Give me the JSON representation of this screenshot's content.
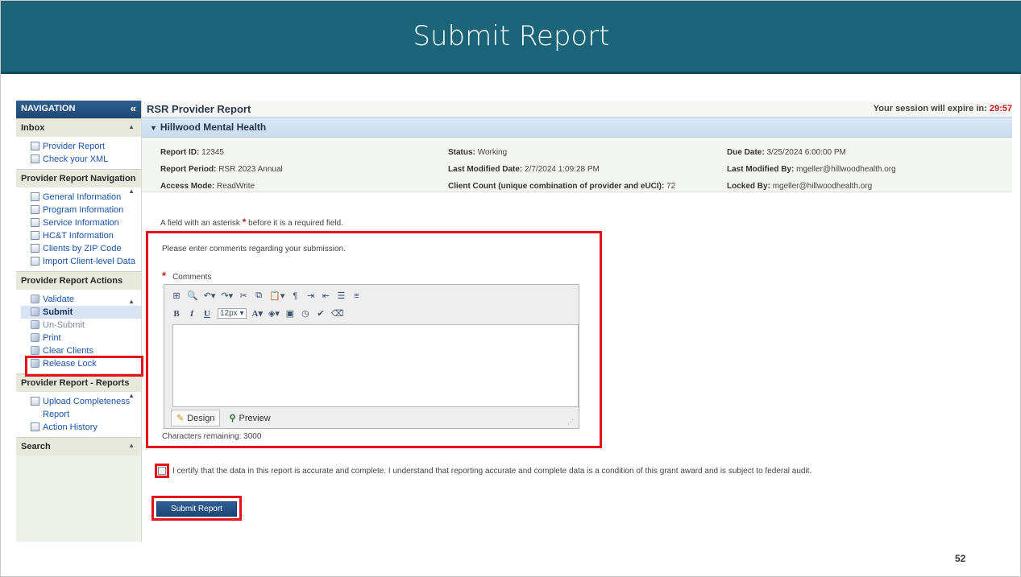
{
  "slide": {
    "title": "Submit Report",
    "page_number": "52",
    "title_bar_color": "#1c6478"
  },
  "sidebar": {
    "header": "NAVIGATION",
    "collapse_icon": "double-chevron-left-icon",
    "sections": [
      {
        "label": "Inbox",
        "items": [
          "Provider Report",
          "Check your XML"
        ]
      },
      {
        "label": "Provider Report Navigation",
        "items": [
          "General Information",
          "Program Information",
          "Service Information",
          "HC&T Information",
          "Clients by ZIP Code",
          "Import Client-level Data"
        ]
      },
      {
        "label": "Provider Report Actions",
        "items": [
          "Validate",
          "Submit",
          "Un-Submit",
          "Print",
          "Clear Clients",
          "Release Lock"
        ],
        "selected": "Submit"
      },
      {
        "label": "Provider Report - Reports",
        "items": [
          "Upload Completeness Report",
          "Action History"
        ]
      },
      {
        "label": "Search",
        "items": []
      }
    ]
  },
  "main": {
    "title": "RSR Provider Report",
    "session_label": "Your session will expire in:",
    "session_timer": "29:57",
    "org_name": "Hillwood Mental Health",
    "info": {
      "report_id_label": "Report ID:",
      "report_id": "12345",
      "report_period_label": "Report Period:",
      "report_period": "RSR 2023 Annual",
      "access_mode_label": "Access Mode:",
      "access_mode": "ReadWrite",
      "status_label": "Status:",
      "status": "Working",
      "last_modified_date_label": "Last Modified Date:",
      "last_modified_date": "2/7/2024  1:09:28 PM",
      "client_count_label": "Client Count (unique combination of provider and eUCI):",
      "client_count": "72",
      "due_date_label": "Due Date:",
      "due_date": "3/25/2024  6:00:00 PM",
      "last_modified_by_label": "Last Modified By:",
      "last_modified_by": "mgeller@hillwoodhealth.org",
      "locked_by_label": "Locked By:",
      "locked_by": "mgeller@hillwoodhealth.org"
    },
    "required_note_prefix": "A field with an asterisk",
    "required_note_suffix": "before it is a required field.",
    "comments_prompt": "Please enter comments regarding your submission.",
    "comments_label": "Comments",
    "editor": {
      "font_size": "12px",
      "design_tab": "Design",
      "preview_tab": "Preview"
    },
    "chars_remaining": "Characters remaining: 3000",
    "certify_text": "I certify that the data in this report is accurate and complete. I understand that reporting accurate and complete data is a condition of this grant award and is subject to federal audit.",
    "submit_button": "Submit Report"
  },
  "colors": {
    "highlight": "#e8101a",
    "link": "#1a55a8",
    "timer": "#c0181b"
  }
}
